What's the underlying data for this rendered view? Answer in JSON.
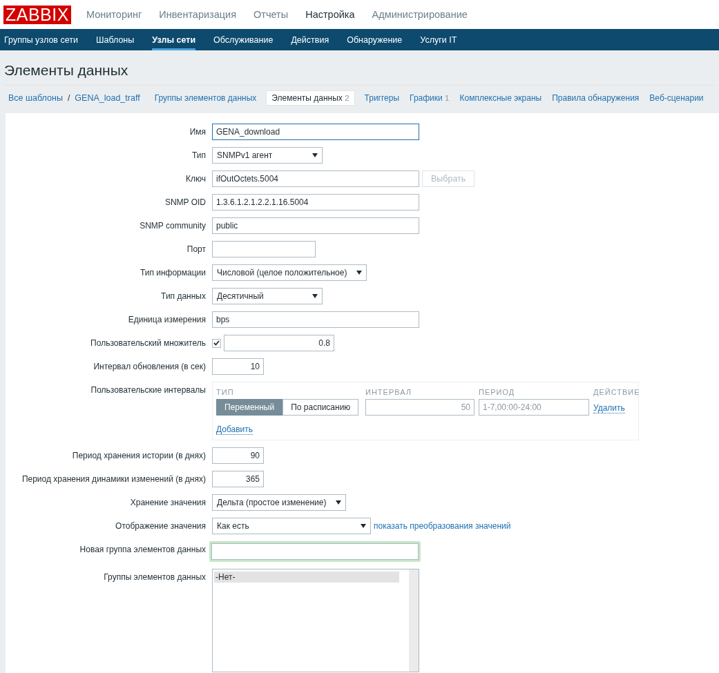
{
  "logo": "ZABBIX",
  "top_menu": [
    {
      "label": "Мониторинг",
      "selected": false
    },
    {
      "label": "Инвентаризация",
      "selected": false
    },
    {
      "label": "Отчеты",
      "selected": false
    },
    {
      "label": "Настройка",
      "selected": true
    },
    {
      "label": "Администрирование",
      "selected": false
    }
  ],
  "sub_menu": [
    {
      "label": "Группы узлов сети",
      "selected": false
    },
    {
      "label": "Шаблоны",
      "selected": false
    },
    {
      "label": "Узлы сети",
      "selected": true
    },
    {
      "label": "Обслуживание",
      "selected": false
    },
    {
      "label": "Действия",
      "selected": false
    },
    {
      "label": "Обнаружение",
      "selected": false
    },
    {
      "label": "Услуги IT",
      "selected": false
    }
  ],
  "page_title": "Элементы данных",
  "breadcrumbs": {
    "items": [
      "Все шаблоны",
      "GENA_load_traff"
    ],
    "separator": "/"
  },
  "tabs": [
    {
      "label": "Группы элементов данных",
      "selected": false
    },
    {
      "label": "Элементы данных",
      "count": "2",
      "selected": true
    },
    {
      "label": "Триггеры",
      "selected": false
    },
    {
      "label": "Графики",
      "count": "1",
      "selected": false
    },
    {
      "label": "Комплексные экраны",
      "selected": false
    },
    {
      "label": "Правила обнаружения",
      "selected": false
    },
    {
      "label": "Веб-сценарии",
      "selected": false
    }
  ],
  "form": [
    {
      "kind": "text",
      "label": "Имя",
      "value": "GENA_download",
      "focused": true
    },
    {
      "kind": "select",
      "label": "Тип",
      "value": "SNMPv1 агент"
    },
    {
      "kind": "text",
      "label": "Ключ",
      "value": "ifOutOctets.5004",
      "button": {
        "label": "Выбрать",
        "disabled": true
      }
    },
    {
      "kind": "text",
      "label": "SNMP OID",
      "value": "1.3.6.1.2.1.2.2.1.16.5004"
    },
    {
      "kind": "text",
      "label": "SNMP community",
      "value": "public"
    },
    {
      "kind": "short",
      "label": "Порт"
    },
    {
      "kind": "select",
      "label": "Тип информации",
      "value": "Числовой (целое положительное)"
    },
    {
      "kind": "select",
      "label": "Тип данных",
      "value": "Десятичный"
    },
    {
      "kind": "text",
      "label": "Единица измерения",
      "value": "bps"
    },
    {
      "kind": "multiplier",
      "label": "Пользовательский множитель",
      "checked": true,
      "value": "0.8"
    },
    {
      "kind": "number",
      "label": "Интервал обновления (в сек)",
      "value": "10"
    },
    {
      "kind": "intervals",
      "label": "Пользовательские интервалы",
      "columns": [
        "ТИП",
        "ИНТЕРВАЛ",
        "ПЕРИОД",
        "ДЕЙСТВИЕ"
      ],
      "rows": [
        {
          "options": [
            {
              "label": "Переменный",
              "selected": true
            },
            {
              "label": "По расписанию",
              "selected": false
            }
          ],
          "interval_placeholder": "50",
          "period_placeholder": "1-7,00:00-24:00",
          "action": "Удалить"
        }
      ],
      "add_link": "Добавить"
    },
    {
      "kind": "number",
      "label": "Период хранения истории (в днях)",
      "value": "90"
    },
    {
      "kind": "number",
      "label": "Период хранения динамики изменений (в днях)",
      "value": "365"
    },
    {
      "kind": "select",
      "label": "Хранение значения",
      "value": "Дельта (простое изменение)"
    },
    {
      "kind": "select",
      "label": "Отображение значения",
      "value": "Как есть",
      "link": "показать преобразования значений"
    },
    {
      "kind": "text",
      "label": "Новая группа элементов данных",
      "highlighted": true
    },
    {
      "kind": "listbox",
      "label": "Группы элементов данных",
      "items": [
        {
          "label": "-Нет-",
          "selected": true
        }
      ]
    }
  ]
}
